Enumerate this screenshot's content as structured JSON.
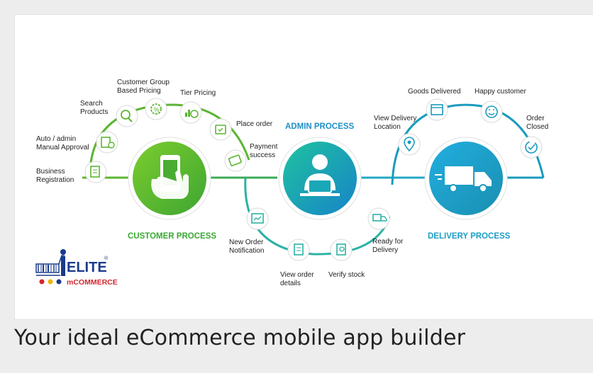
{
  "caption": "Your ideal eCommerce mobile app builder",
  "colors": {
    "green": "#58b82c",
    "blue": "#1e9fd6",
    "teal": "#1a9bbd",
    "navy": "#1a3a8c",
    "red": "#d4272e"
  },
  "headers": {
    "customer": "CUSTOMER PROCESS",
    "admin": "ADMIN PROCESS",
    "delivery": "DELIVERY PROCESS"
  },
  "customer_steps": {
    "business": [
      "Business",
      "Registration"
    ],
    "approval": [
      "Auto / admin",
      "Manual Approval"
    ],
    "search": [
      "Search",
      "Products"
    ],
    "group_pricing": [
      "Customer Group",
      "Based  Pricing"
    ],
    "tier": [
      "Tier Pricing"
    ],
    "place_order": [
      "Place order"
    ],
    "payment": [
      "Payment",
      "success"
    ]
  },
  "admin_steps": {
    "new_order": [
      "New Order",
      "Notification"
    ],
    "view_order": [
      "View order",
      "details"
    ],
    "verify_stock": [
      "Verify stock"
    ],
    "ready": [
      "Ready for",
      "Delivery"
    ]
  },
  "delivery_steps": {
    "view_location": [
      "View Delivery",
      "Location"
    ],
    "goods_delivered": [
      "Goods Delivered"
    ],
    "happy": [
      "Happy customer"
    ],
    "closed": [
      "Order",
      "Closed"
    ]
  },
  "logo": {
    "word1": "ELITE",
    "word2": "mCOMMERCE",
    "mark": "®"
  }
}
